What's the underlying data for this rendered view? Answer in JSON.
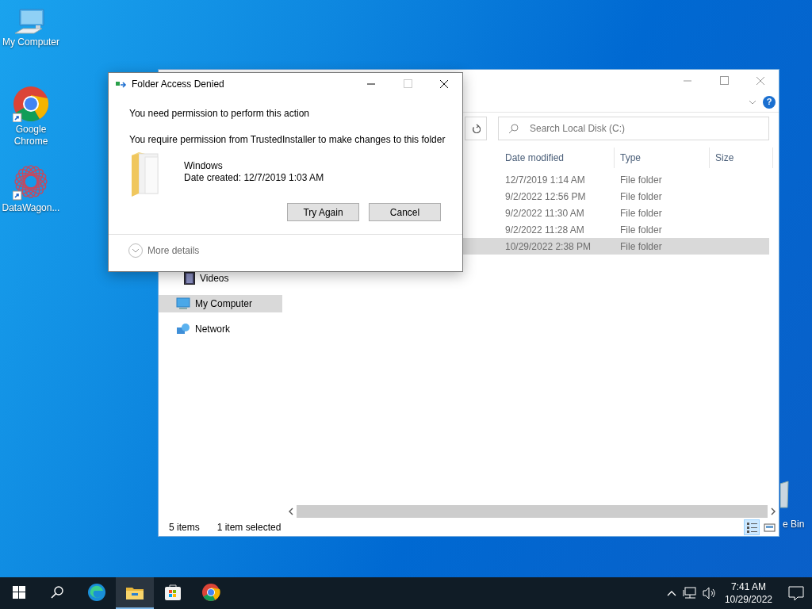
{
  "desktop_icons": [
    {
      "label": "My Computer",
      "kind": "computer",
      "shortcut": false
    },
    {
      "label": "Google Chrome",
      "kind": "chrome",
      "shortcut": true
    },
    {
      "label": "DataWagon...",
      "kind": "datawagon",
      "shortcut": true
    }
  ],
  "recycle_bin": {
    "label": "e Bin"
  },
  "explorer": {
    "help_glyph": "?",
    "search": {
      "placeholder": "Search Local Disk (C:)"
    },
    "columns": [
      "Date modified",
      "Type",
      "Size"
    ],
    "rows": [
      {
        "date_modified": "12/7/2019 1:14 AM",
        "type": "File folder",
        "selected": false
      },
      {
        "date_modified": "9/2/2022 12:56 PM",
        "type": "File folder",
        "selected": false
      },
      {
        "date_modified": "9/2/2022 11:30 AM",
        "type": "File folder",
        "selected": false
      },
      {
        "date_modified": "9/2/2022 11:28 AM",
        "type": "File folder",
        "selected": false
      },
      {
        "date_modified": "10/29/2022 2:38 PM",
        "type": "File folder",
        "selected": true
      }
    ],
    "nav": [
      {
        "label": "Videos",
        "kind": "videos",
        "selected": false
      },
      {
        "label": "My Computer",
        "kind": "computer",
        "selected": true
      },
      {
        "label": "Network",
        "kind": "network",
        "selected": false
      }
    ],
    "status": {
      "count": "5 items",
      "selection": "1 item selected"
    },
    "views": [
      {
        "kind": "details",
        "selected": true
      },
      {
        "kind": "tiles",
        "selected": false
      }
    ]
  },
  "dialog": {
    "title": "Folder Access Denied",
    "heading": "You need permission to perform this action",
    "message": "You require permission from TrustedInstaller to make changes to this folder",
    "item": {
      "name": "Windows",
      "date_created": "Date created: 12/7/2019 1:03 AM"
    },
    "buttons": [
      "Try Again",
      "Cancel"
    ],
    "details_toggle": {
      "label": "More details",
      "expanded": false
    }
  },
  "taskbar": {
    "apps": [
      {
        "kind": "start",
        "active": false
      },
      {
        "kind": "search",
        "active": false
      },
      {
        "kind": "edge",
        "active": false
      },
      {
        "kind": "explorer",
        "active": true
      },
      {
        "kind": "store",
        "active": false
      },
      {
        "kind": "chrome",
        "active": false
      }
    ],
    "time": "7:41 AM",
    "date": "10/29/2022"
  }
}
